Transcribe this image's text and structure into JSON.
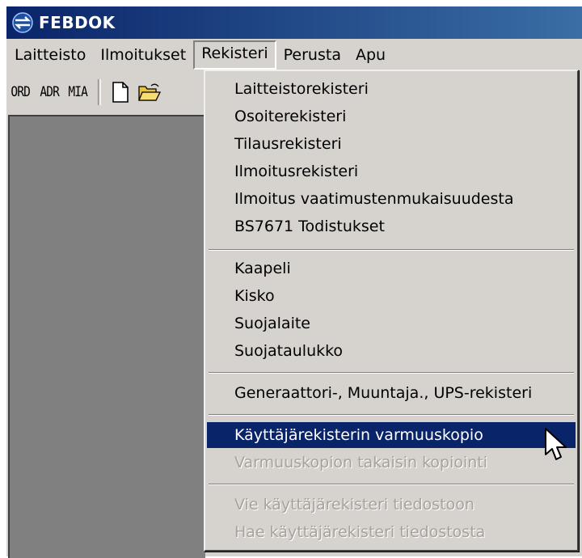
{
  "window": {
    "title": "FEBDOK"
  },
  "menubar": {
    "items": [
      "Laitteisto",
      "Ilmoitukset",
      "Rekisteri",
      "Perusta",
      "Apu"
    ],
    "open_item": "Rekisteri"
  },
  "toolbar": {
    "buttons": [
      "ORD",
      "ADR",
      "MIA"
    ],
    "icons": [
      "new-document-icon",
      "open-folder-icon"
    ]
  },
  "dropdown": {
    "items": [
      {
        "label": "Laitteistorekisteri",
        "enabled": true
      },
      {
        "label": "Osoiterekisteri",
        "enabled": true
      },
      {
        "label": "Tilausrekisteri",
        "enabled": true
      },
      {
        "label": "Ilmoitusrekisteri",
        "enabled": true
      },
      {
        "label": "Ilmoitus vaatimustenmukaisuudesta",
        "enabled": true
      },
      {
        "label": "BS7671 Todistukset",
        "enabled": true
      },
      {
        "label": "Kaapeli",
        "enabled": true
      },
      {
        "label": "Kisko",
        "enabled": true
      },
      {
        "label": "Suojalaite",
        "enabled": true
      },
      {
        "label": "Suojataulukko",
        "enabled": true
      },
      {
        "label": "Generaattori-, Muuntaja., UPS-rekisteri",
        "enabled": true
      },
      {
        "label": "Käyttäjärekisterin varmuuskopio",
        "enabled": true,
        "highlighted": true
      },
      {
        "label": "Varmuuskopion takaisin kopiointi",
        "enabled": false
      },
      {
        "label": "Vie käyttäjärekisteri tiedostoon",
        "enabled": false
      },
      {
        "label": "Hae käyttäjärekisteri tiedostosta",
        "enabled": false
      }
    ]
  },
  "colors": {
    "titlebar": "#0a246a",
    "highlight": "#0a246a",
    "face": "#d6d3ce",
    "workspace": "#808080"
  }
}
